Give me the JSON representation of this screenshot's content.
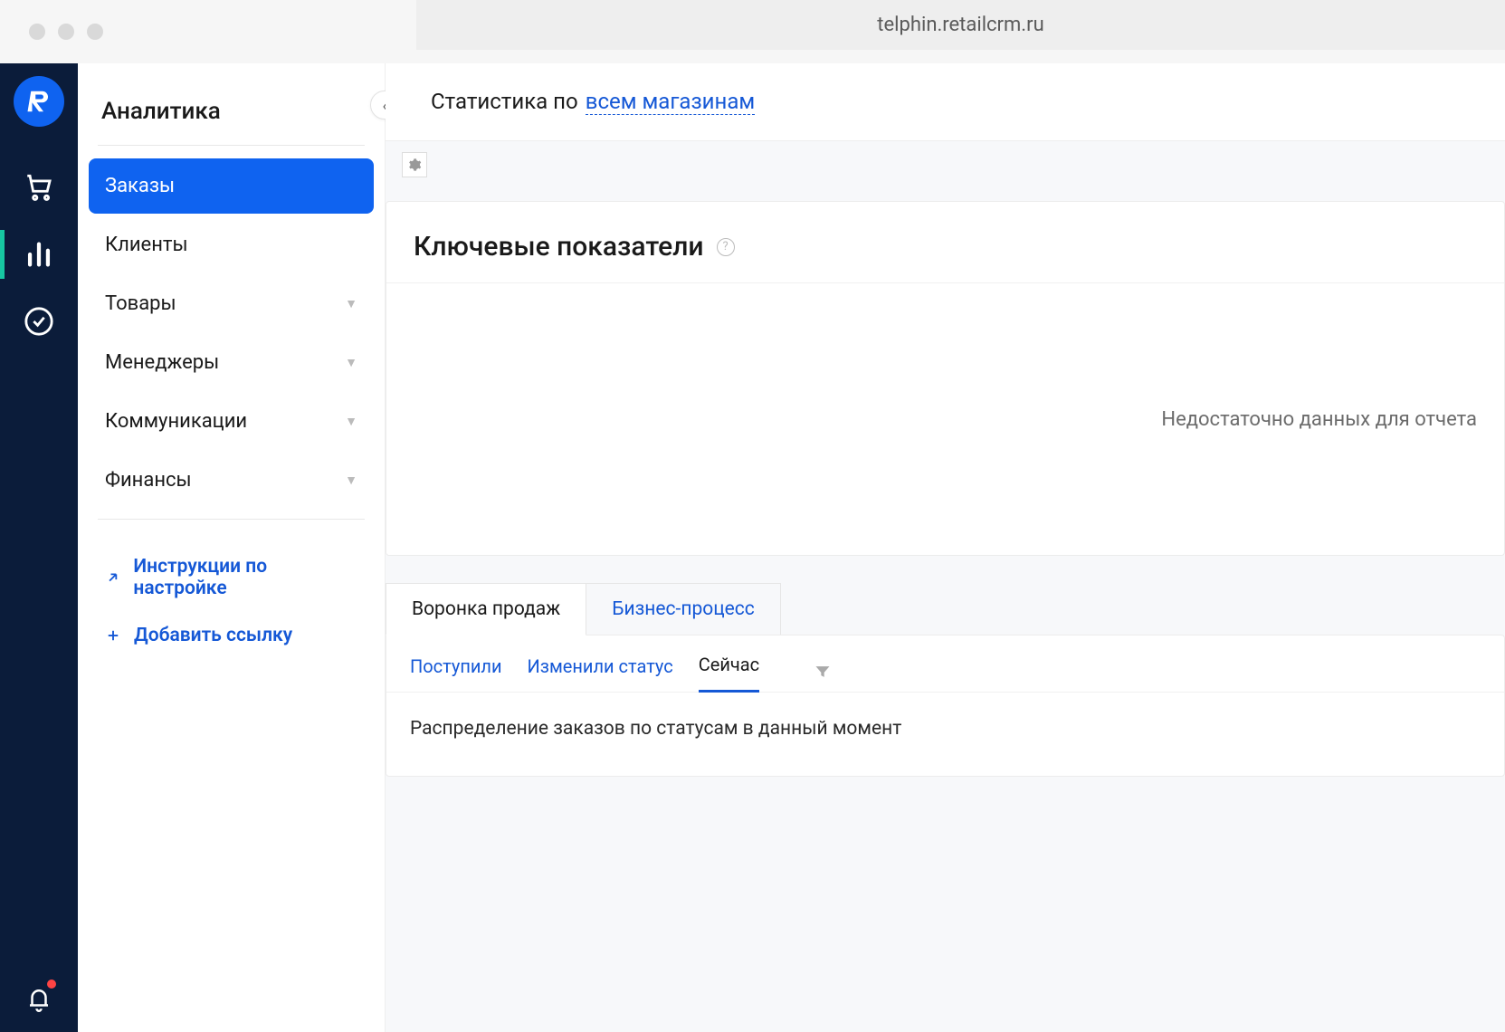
{
  "browser": {
    "url": "telphin.retailcrm.ru"
  },
  "rail": {
    "items": [
      {
        "name": "cart-icon",
        "active": false
      },
      {
        "name": "analytics-icon",
        "active": true
      },
      {
        "name": "checkmark-icon",
        "active": false
      }
    ],
    "bottom": {
      "name": "notifications-icon",
      "has_badge": true
    }
  },
  "submenu": {
    "title": "Аналитика",
    "items": [
      {
        "label": "Заказы",
        "active": true,
        "has_children": false
      },
      {
        "label": "Клиенты",
        "active": false,
        "has_children": false
      },
      {
        "label": "Товары",
        "active": false,
        "has_children": true
      },
      {
        "label": "Менеджеры",
        "active": false,
        "has_children": true
      },
      {
        "label": "Коммуникации",
        "active": false,
        "has_children": true
      },
      {
        "label": "Финансы",
        "active": false,
        "has_children": true
      }
    ],
    "links": [
      {
        "label": "Инструкции по настройке",
        "icon": "external-link-icon"
      },
      {
        "label": "Добавить ссылку",
        "icon": "plus-icon"
      }
    ]
  },
  "header": {
    "prefix": "Статистика по",
    "link": "всем магазинам"
  },
  "kpi_card": {
    "title": "Ключевые показатели",
    "empty_message": "Недостаточно данных для отчета"
  },
  "funnel": {
    "major_tabs": [
      {
        "label": "Воронка продаж",
        "active": true
      },
      {
        "label": "Бизнес-процесс",
        "active": false
      }
    ],
    "minor_tabs": [
      {
        "label": "Поступили",
        "active": false
      },
      {
        "label": "Изменили статус",
        "active": false
      },
      {
        "label": "Сейчас",
        "active": true
      }
    ],
    "description": "Распределение заказов по статусам в данный момент"
  }
}
